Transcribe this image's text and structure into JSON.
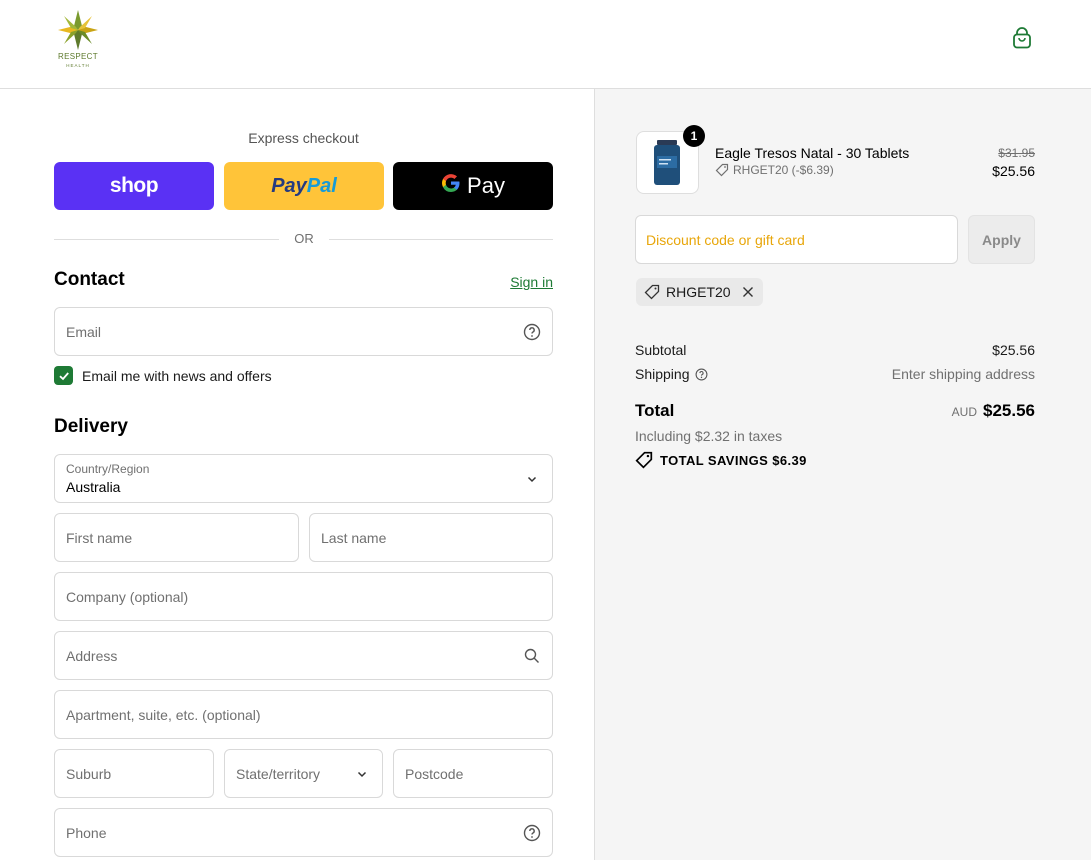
{
  "header": {
    "logo": {
      "name": "RESPECT",
      "sub": "HEALTH"
    }
  },
  "express": {
    "title": "Express checkout",
    "buttons": {
      "shop": "shop",
      "paypal_1": "Pay",
      "paypal_2": "Pal",
      "gpay_g": "G",
      "gpay": "Pay"
    },
    "or": "OR"
  },
  "contact": {
    "title": "Contact",
    "signin": "Sign in",
    "email_placeholder": "Email",
    "newsletter_label": "Email me with news and offers",
    "newsletter_checked": true
  },
  "delivery": {
    "title": "Delivery",
    "country_label": "Country/Region",
    "country_value": "Australia",
    "first_name": "First name",
    "last_name": "Last name",
    "company": "Company (optional)",
    "address": "Address",
    "apartment": "Apartment, suite, etc. (optional)",
    "suburb": "Suburb",
    "state": "State/territory",
    "postcode": "Postcode",
    "phone": "Phone"
  },
  "summary": {
    "item": {
      "quantity": "1",
      "name": "Eagle Tresos Natal - 30 Tablets",
      "discount": "RHGET20 (-$6.39)",
      "old_price": "$31.95",
      "price": "$25.56"
    },
    "discount_placeholder": "Discount code or gift card",
    "apply": "Apply",
    "applied_code": "RHGET20",
    "subtotal_label": "Subtotal",
    "subtotal_value": "$25.56",
    "shipping_label": "Shipping",
    "shipping_value": "Enter shipping address",
    "total_label": "Total",
    "currency": "AUD",
    "total_value": "$25.56",
    "taxes": "Including $2.32 in taxes",
    "savings": "TOTAL SAVINGS $6.39"
  },
  "colors": {
    "shop": "#5a31f4",
    "paypal": "#ffc439",
    "gpay": "#000000",
    "accent_green": "#1e7a35",
    "placeholder_orange": "#e8a60a"
  }
}
